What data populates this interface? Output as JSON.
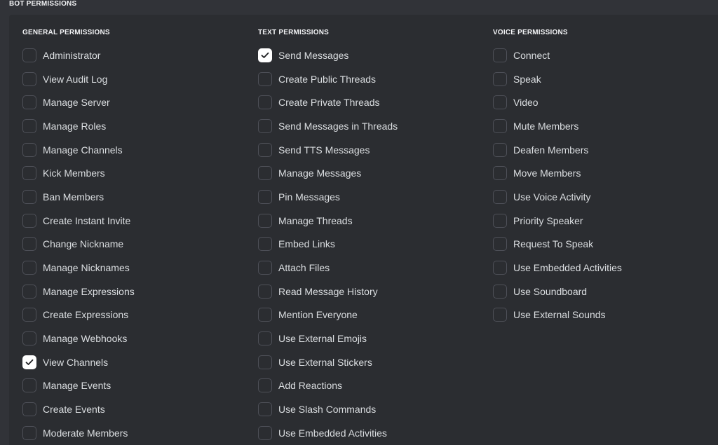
{
  "section_title": "BOT PERMISSIONS",
  "columns": [
    {
      "header": "GENERAL PERMISSIONS",
      "items": [
        {
          "label": "Administrator",
          "checked": false
        },
        {
          "label": "View Audit Log",
          "checked": false
        },
        {
          "label": "Manage Server",
          "checked": false
        },
        {
          "label": "Manage Roles",
          "checked": false
        },
        {
          "label": "Manage Channels",
          "checked": false
        },
        {
          "label": "Kick Members",
          "checked": false
        },
        {
          "label": "Ban Members",
          "checked": false
        },
        {
          "label": "Create Instant Invite",
          "checked": false
        },
        {
          "label": "Change Nickname",
          "checked": false
        },
        {
          "label": "Manage Nicknames",
          "checked": false
        },
        {
          "label": "Manage Expressions",
          "checked": false
        },
        {
          "label": "Create Expressions",
          "checked": false
        },
        {
          "label": "Manage Webhooks",
          "checked": false
        },
        {
          "label": "View Channels",
          "checked": true
        },
        {
          "label": "Manage Events",
          "checked": false
        },
        {
          "label": "Create Events",
          "checked": false
        },
        {
          "label": "Moderate Members",
          "checked": false
        }
      ]
    },
    {
      "header": "TEXT PERMISSIONS",
      "items": [
        {
          "label": "Send Messages",
          "checked": true
        },
        {
          "label": "Create Public Threads",
          "checked": false
        },
        {
          "label": "Create Private Threads",
          "checked": false
        },
        {
          "label": "Send Messages in Threads",
          "checked": false
        },
        {
          "label": "Send TTS Messages",
          "checked": false
        },
        {
          "label": "Manage Messages",
          "checked": false
        },
        {
          "label": "Pin Messages",
          "checked": false
        },
        {
          "label": "Manage Threads",
          "checked": false
        },
        {
          "label": "Embed Links",
          "checked": false
        },
        {
          "label": "Attach Files",
          "checked": false
        },
        {
          "label": "Read Message History",
          "checked": false
        },
        {
          "label": "Mention Everyone",
          "checked": false
        },
        {
          "label": "Use External Emojis",
          "checked": false
        },
        {
          "label": "Use External Stickers",
          "checked": false
        },
        {
          "label": "Add Reactions",
          "checked": false
        },
        {
          "label": "Use Slash Commands",
          "checked": false
        },
        {
          "label": "Use Embedded Activities",
          "checked": false
        }
      ]
    },
    {
      "header": "VOICE PERMISSIONS",
      "items": [
        {
          "label": "Connect",
          "checked": false
        },
        {
          "label": "Speak",
          "checked": false
        },
        {
          "label": "Video",
          "checked": false
        },
        {
          "label": "Mute Members",
          "checked": false
        },
        {
          "label": "Deafen Members",
          "checked": false
        },
        {
          "label": "Move Members",
          "checked": false
        },
        {
          "label": "Use Voice Activity",
          "checked": false
        },
        {
          "label": "Priority Speaker",
          "checked": false
        },
        {
          "label": "Request To Speak",
          "checked": false
        },
        {
          "label": "Use Embedded Activities",
          "checked": false
        },
        {
          "label": "Use Soundboard",
          "checked": false
        },
        {
          "label": "Use External Sounds",
          "checked": false
        }
      ]
    }
  ],
  "colors": {
    "background": "#313338",
    "panel": "#2b2d31",
    "checkbox_border": "#4e5058",
    "checkbox_checked": "#ffffff",
    "text": "#dbdee1"
  }
}
